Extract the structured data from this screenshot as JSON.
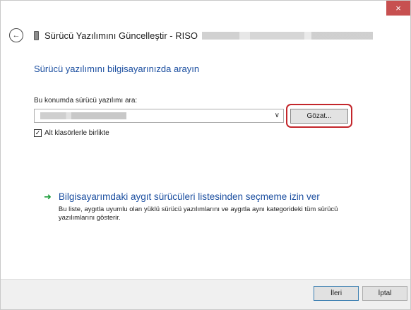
{
  "window": {
    "close_glyph": "×",
    "accent_color": "#1c4fa0",
    "close_color": "#c75050"
  },
  "header": {
    "back_icon": "back-arrow-icon",
    "device_icon": "device-icon",
    "title": "Sürücü Yazılımını Güncelleştir - RISO"
  },
  "main": {
    "heading": "Sürücü yazılımını bilgisayarınızda arayın",
    "location_label": "Bu konumda sürücü yazılımı ara:",
    "browse_label": "Gözat...",
    "include_subfolders_label": "Alt klasörlerle birlikte",
    "include_subfolders_checked": true,
    "pick_title": "Bilgisayarımdaki aygıt sürücüleri listesinden seçmeme izin ver",
    "pick_desc": "Bu liste, aygıtla uyumlu olan yüklü sürücü yazılımlarını ve aygıtla aynı kategorideki tüm sürücü yazılımlarını gösterir."
  },
  "footer": {
    "next_label": "İleri",
    "cancel_label": "İptal"
  }
}
